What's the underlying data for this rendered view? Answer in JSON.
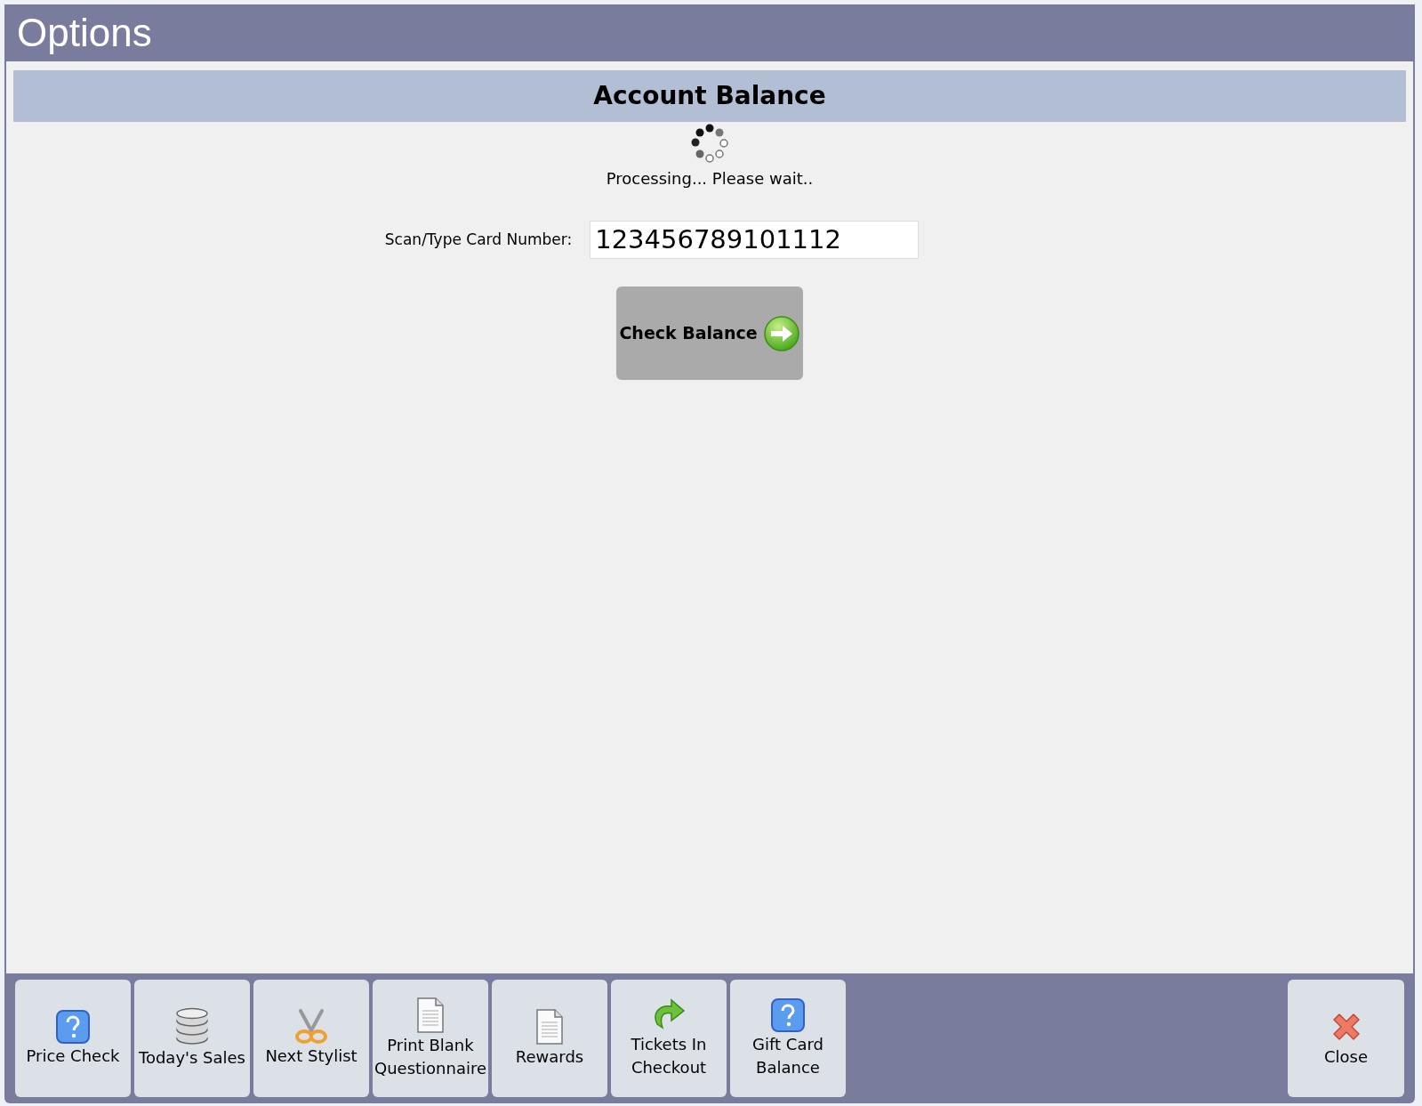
{
  "window": {
    "title": "Options"
  },
  "panel": {
    "heading": "Account Balance",
    "status": "Processing... Please wait..",
    "card_label": "Scan/Type Card Number:",
    "card_value": "123456789101112",
    "button": "Check Balance"
  },
  "toolbar": [
    {
      "label": "Price Check",
      "kind": "help"
    },
    {
      "label": "Today's Sales",
      "kind": "database"
    },
    {
      "label": "Next Stylist",
      "kind": "scissors"
    },
    {
      "label": "Print Blank Questionnaire",
      "kind": "document"
    },
    {
      "label": "Rewards",
      "kind": "document"
    },
    {
      "label": "Tickets In Checkout",
      "kind": "redo"
    },
    {
      "label": "Gift Card Balance",
      "kind": "help"
    }
  ],
  "close_button": {
    "label": "Close"
  }
}
